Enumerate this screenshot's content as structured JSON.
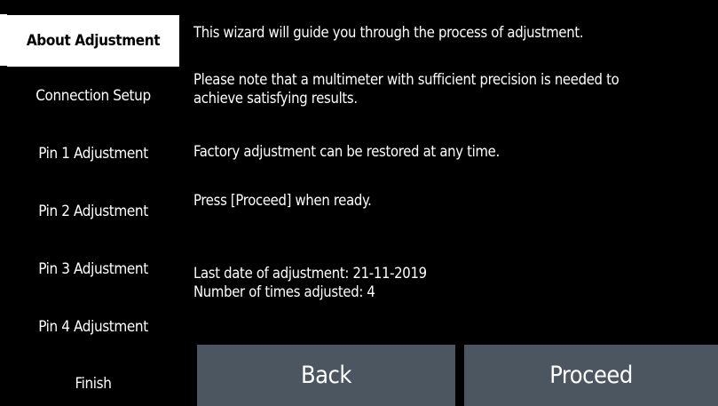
{
  "sidebar": {
    "steps": [
      {
        "label": "About Adjustment",
        "active": true
      },
      {
        "label": "Connection Setup",
        "active": false
      },
      {
        "label": "Pin 1 Adjustment",
        "active": false
      },
      {
        "label": "Pin 2 Adjustment",
        "active": false
      },
      {
        "label": "Pin 3 Adjustment",
        "active": false
      },
      {
        "label": "Pin 4 Adjustment",
        "active": false
      },
      {
        "label": "Finish",
        "active": false
      }
    ]
  },
  "content": {
    "intro": "This wizard will guide you through the process of adjustment.",
    "multimeter_line1": "Please note that a multimeter with sufficient precision is needed to",
    "multimeter_line2": "achieve satisfying results.",
    "factory_note": "Factory adjustment can be restored at any time.",
    "proceed_hint": "Press [Proceed] when ready.",
    "last_date": "Last date of adjustment: 21-11-2019",
    "times_adjusted": "Number of times adjusted: 4"
  },
  "buttons": {
    "back_label": "Back",
    "proceed_label": "Proceed"
  },
  "colors": {
    "background": "#000000",
    "active_step_bg": "#ffffff",
    "button_bg": "#4b5660",
    "text": "#ffffff"
  }
}
